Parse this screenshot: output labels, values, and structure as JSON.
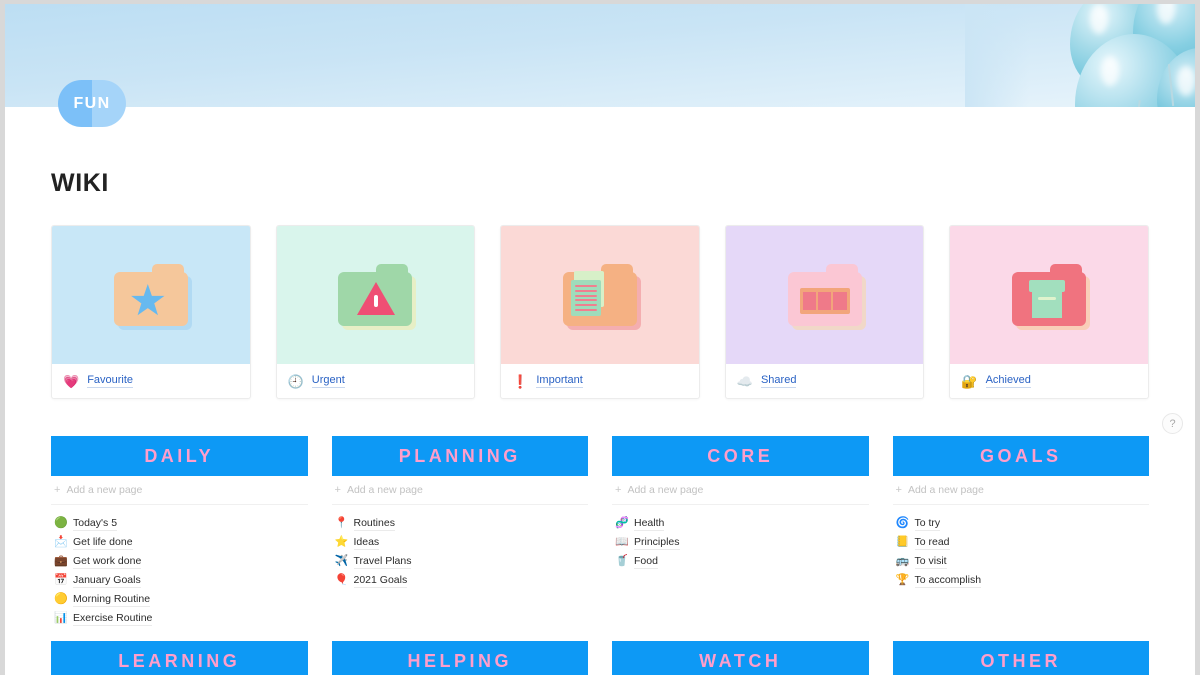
{
  "window": {
    "logo_text": "FUN",
    "page_title": "WIKI"
  },
  "help": {
    "label": "?"
  },
  "gallery": {
    "cards": [
      {
        "label": "Favourite",
        "emoji": "💗",
        "cover_color": "#c8e7f7",
        "folder_color": "#f5c79b",
        "folder_shadow": "#9ecff0",
        "art": "star"
      },
      {
        "label": "Urgent",
        "emoji": "🕘",
        "cover_color": "#d9f5ec",
        "folder_color": "#9fd7a8",
        "folder_shadow": "#f2e9a8",
        "art": "warning"
      },
      {
        "label": "Important",
        "emoji": "❗",
        "cover_color": "#fbd9d6",
        "folder_color": "#f5b183",
        "folder_shadow": "#ef8a92",
        "art": "document"
      },
      {
        "label": "Shared",
        "emoji": "☁️",
        "cover_color": "#e5d8f8",
        "folder_color": "#fbc7d4",
        "folder_shadow": "#fbd9a0",
        "art": "film"
      },
      {
        "label": "Achieved",
        "emoji": "🔐",
        "cover_color": "#fbd9e8",
        "folder_color": "#f0737f",
        "folder_shadow": "#f7c48f",
        "art": "box"
      }
    ]
  },
  "board": {
    "add_page_label": "Add a new page",
    "plus": "+",
    "columns": [
      {
        "title": "DAILY",
        "items": [
          {
            "emoji": "🟢",
            "label": "Today's 5"
          },
          {
            "emoji": "📩",
            "label": "Get life done"
          },
          {
            "emoji": "💼",
            "label": "Get work done"
          },
          {
            "emoji": "📅",
            "label": "January Goals"
          },
          {
            "emoji": "🟡",
            "label": "Morning Routine"
          },
          {
            "emoji": "📊",
            "label": "Exercise Routine"
          }
        ]
      },
      {
        "title": "PLANNING",
        "items": [
          {
            "emoji": "📍",
            "label": "Routines"
          },
          {
            "emoji": "⭐",
            "label": "Ideas"
          },
          {
            "emoji": "✈️",
            "label": "Travel Plans"
          },
          {
            "emoji": "🎈",
            "label": "2021 Goals"
          }
        ]
      },
      {
        "title": "CORE",
        "items": [
          {
            "emoji": "🧬",
            "label": "Health"
          },
          {
            "emoji": "📖",
            "label": "Principles"
          },
          {
            "emoji": "🥤",
            "label": "Food"
          }
        ]
      },
      {
        "title": "GOALS",
        "items": [
          {
            "emoji": "🌀",
            "label": "To try"
          },
          {
            "emoji": "📒",
            "label": "To read"
          },
          {
            "emoji": "🚌",
            "label": "To visit"
          },
          {
            "emoji": "🏆",
            "label": "To accomplish"
          }
        ]
      }
    ],
    "columns_bottom": [
      {
        "title": "LEARNING"
      },
      {
        "title": "HELPING"
      },
      {
        "title": "WATCH"
      },
      {
        "title": "OTHER"
      }
    ]
  }
}
